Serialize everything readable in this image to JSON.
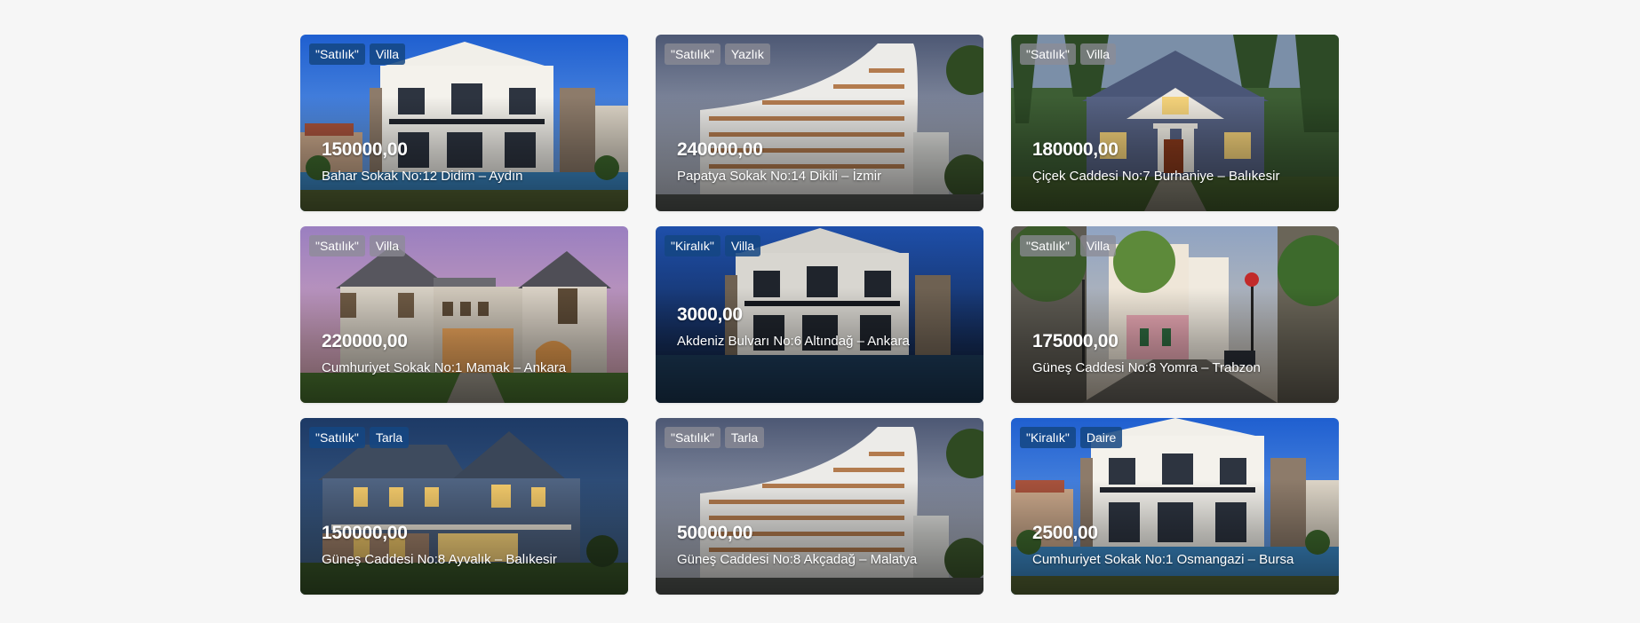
{
  "listings": [
    {
      "status": "\"Satılık\"",
      "type": "Villa",
      "price": "150000,00",
      "address": "Bahar Sokak No:12 Didim – Aydın",
      "image": "white-villa-pool",
      "sky": "#2c6fd8"
    },
    {
      "status": "\"Satılık\"",
      "type": "Yazlık",
      "price": "240000,00",
      "address": "Papatya Sokak No:14 Dikili – İzmir",
      "image": "curved-apartment-block",
      "sky": "#5e6a88"
    },
    {
      "status": "\"Satılık\"",
      "type": "Villa",
      "price": "180000,00",
      "address": "Çiçek Caddesi No:7 Burhaniye – Balıkesir",
      "image": "craftsman-house-forest",
      "sky": "#4a6a3a"
    },
    {
      "status": "\"Satılık\"",
      "type": "Villa",
      "price": "220000,00",
      "address": "Cumhuriyet Sokak No:1 Mamak – Ankara",
      "image": "stone-house-sunset",
      "sky": "#b487b8"
    },
    {
      "status": "\"Kiralık\"",
      "type": "Villa",
      "price": "3000,00",
      "address": "Akdeniz Bulvarı No:6 Altındağ – Ankara",
      "image": "white-villa-night",
      "sky": "#173d8a"
    },
    {
      "status": "\"Satılık\"",
      "type": "Villa",
      "price": "175000,00",
      "address": "Güneş Caddesi No:8 Yomra – Trabzon",
      "image": "montmartre-street",
      "sky": "#a9b7c9"
    },
    {
      "status": "\"Satılık\"",
      "type": "Tarla",
      "price": "150000,00",
      "address": "Güneş Caddesi No:8 Ayvalık – Balıkesir",
      "image": "blue-house-dusk",
      "sky": "#23456e"
    },
    {
      "status": "\"Satılık\"",
      "type": "Tarla",
      "price": "50000,00",
      "address": "Güneş Caddesi No:8 Akçadağ – Malatya",
      "image": "curved-apartment-block",
      "sky": "#5e6a88"
    },
    {
      "status": "\"Kiralık\"",
      "type": "Daire",
      "price": "2500,00",
      "address": "Cumhuriyet Sokak No:1 Osmangazi – Bursa",
      "image": "white-villa-pool",
      "sky": "#2c6fd8"
    }
  ]
}
